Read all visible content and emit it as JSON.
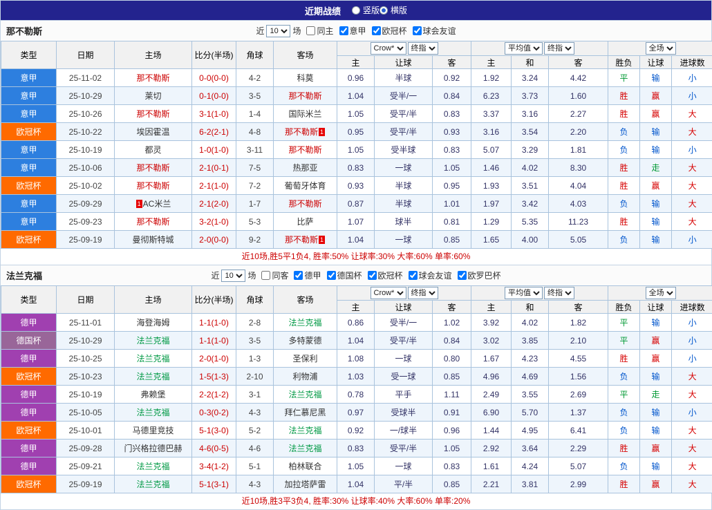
{
  "topbar": {
    "title": "近期战绩",
    "radios": [
      {
        "label": "竖版",
        "selected": false
      },
      {
        "label": "横版",
        "selected": true
      }
    ]
  },
  "columns": {
    "left": [
      "类型",
      "日期",
      "主场",
      "比分(半场)",
      "角球",
      "客场"
    ],
    "asia": [
      "主",
      "让球",
      "客"
    ],
    "euro": [
      "主",
      "和",
      "客"
    ],
    "result": [
      "胜负",
      "让球",
      "进球数"
    ]
  },
  "colors": {
    "topbar_bg": "#23238e",
    "league": {
      "意甲": "#2d7fdf",
      "欧冠杯": "#ff6a00",
      "德甲": "#a040b0",
      "德国杯": "#996699"
    },
    "team_highlight": {
      "那不勒斯": "#cc0000",
      "法兰克福": "#009944"
    },
    "result_map": {
      "胜": "#d60000",
      "平": "#009933",
      "负": "#0055cc",
      "赢": "#d60000",
      "走": "#009933",
      "输": "#0055cc",
      "大": "#d60000",
      "小": "#0055cc"
    },
    "score": "#cc0000",
    "badge": "#e60000"
  },
  "sections": [
    {
      "team": "那不勒斯",
      "filters": {
        "prefix": "近",
        "count": "10",
        "suffix": "场",
        "checkboxes": [
          {
            "label": "同主",
            "checked": false
          },
          {
            "label": "意甲",
            "checked": true
          },
          {
            "label": "欧冠杯",
            "checked": true
          },
          {
            "label": "球会友谊",
            "checked": true
          }
        ]
      },
      "selectors": {
        "asia": [
          "Crow*",
          "终指"
        ],
        "euro": [
          "平均值",
          "终指"
        ],
        "scope": [
          "全场"
        ]
      },
      "rows": [
        {
          "league": "意甲",
          "date": "25-11-02",
          "home": "那不勒斯",
          "score": "0-0(0-0)",
          "corner": "4-2",
          "away": "科莫",
          "asia_home": "0.96",
          "handicap": "半球",
          "asia_away": "0.92",
          "euro_home": "1.92",
          "euro_draw": "3.24",
          "euro_away": "4.42",
          "result": "平",
          "handicap_result": "输",
          "goals": "小"
        },
        {
          "league": "意甲",
          "date": "25-10-29",
          "home": "莱切",
          "score": "0-1(0-0)",
          "corner": "3-5",
          "away": "那不勒斯",
          "asia_home": "1.04",
          "handicap": "受半/一",
          "asia_away": "0.84",
          "euro_home": "6.23",
          "euro_draw": "3.73",
          "euro_away": "1.60",
          "result": "胜",
          "handicap_result": "赢",
          "goals": "小"
        },
        {
          "league": "意甲",
          "date": "25-10-26",
          "home": "那不勒斯",
          "score": "3-1(1-0)",
          "corner": "1-4",
          "away": "国际米兰",
          "asia_home": "1.05",
          "handicap": "受平/半",
          "asia_away": "0.83",
          "euro_home": "3.37",
          "euro_draw": "3.16",
          "euro_away": "2.27",
          "result": "胜",
          "handicap_result": "赢",
          "goals": "大"
        },
        {
          "league": "欧冠杯",
          "date": "25-10-22",
          "home": "埃因霍温",
          "score": "6-2(2-1)",
          "corner": "4-8",
          "away": "那不勒斯",
          "away_badge": "1",
          "asia_home": "0.95",
          "handicap": "受平/半",
          "asia_away": "0.93",
          "euro_home": "3.16",
          "euro_draw": "3.54",
          "euro_away": "2.20",
          "result": "负",
          "handicap_result": "输",
          "goals": "大"
        },
        {
          "league": "意甲",
          "date": "25-10-19",
          "home": "都灵",
          "score": "1-0(1-0)",
          "corner": "3-11",
          "away": "那不勒斯",
          "asia_home": "1.05",
          "handicap": "受半球",
          "asia_away": "0.83",
          "euro_home": "5.07",
          "euro_draw": "3.29",
          "euro_away": "1.81",
          "result": "负",
          "handicap_result": "输",
          "goals": "小"
        },
        {
          "league": "意甲",
          "date": "25-10-06",
          "home": "那不勒斯",
          "score": "2-1(0-1)",
          "corner": "7-5",
          "away": "热那亚",
          "asia_home": "0.83",
          "handicap": "一球",
          "asia_away": "1.05",
          "euro_home": "1.46",
          "euro_draw": "4.02",
          "euro_away": "8.30",
          "result": "胜",
          "handicap_result": "走",
          "goals": "大"
        },
        {
          "league": "欧冠杯",
          "date": "25-10-02",
          "home": "那不勒斯",
          "score": "2-1(1-0)",
          "corner": "7-2",
          "away": "葡萄牙体育",
          "asia_home": "0.93",
          "handicap": "半球",
          "asia_away": "0.95",
          "euro_home": "1.93",
          "euro_draw": "3.51",
          "euro_away": "4.04",
          "result": "胜",
          "handicap_result": "赢",
          "goals": "大"
        },
        {
          "league": "意甲",
          "date": "25-09-29",
          "home": "AC米兰",
          "home_badge": "1",
          "score": "2-1(2-0)",
          "corner": "1-7",
          "away": "那不勒斯",
          "asia_home": "0.87",
          "handicap": "半球",
          "asia_away": "1.01",
          "euro_home": "1.97",
          "euro_draw": "3.42",
          "euro_away": "4.03",
          "result": "负",
          "handicap_result": "输",
          "goals": "大"
        },
        {
          "league": "意甲",
          "date": "25-09-23",
          "home": "那不勒斯",
          "score": "3-2(1-0)",
          "corner": "5-3",
          "away": "比萨",
          "asia_home": "1.07",
          "handicap": "球半",
          "asia_away": "0.81",
          "euro_home": "1.29",
          "euro_draw": "5.35",
          "euro_away": "11.23",
          "result": "胜",
          "handicap_result": "输",
          "goals": "大"
        },
        {
          "league": "欧冠杯",
          "date": "25-09-19",
          "home": "曼彻斯特城",
          "score": "2-0(0-0)",
          "corner": "9-2",
          "away": "那不勒斯",
          "away_badge": "1",
          "asia_home": "1.04",
          "handicap": "一球",
          "asia_away": "0.85",
          "euro_home": "1.65",
          "euro_draw": "4.00",
          "euro_away": "5.05",
          "result": "负",
          "handicap_result": "输",
          "goals": "小"
        }
      ],
      "summary": "近10场,胜5平1负4, 胜率:50% 让球率:30% 大率:60% 单率:60%"
    },
    {
      "team": "法兰克福",
      "filters": {
        "prefix": "近",
        "count": "10",
        "suffix": "场",
        "checkboxes": [
          {
            "label": "同客",
            "checked": false
          },
          {
            "label": "德甲",
            "checked": true
          },
          {
            "label": "德国杯",
            "checked": true
          },
          {
            "label": "欧冠杯",
            "checked": true
          },
          {
            "label": "球会友谊",
            "checked": true
          },
          {
            "label": "欧罗巴杯",
            "checked": true
          }
        ]
      },
      "selectors": {
        "asia": [
          "Crow*",
          "终指"
        ],
        "euro": [
          "平均值",
          "终指"
        ],
        "scope": [
          "全场"
        ]
      },
      "rows": [
        {
          "league": "德甲",
          "date": "25-11-01",
          "home": "海登海姆",
          "score": "1-1(1-0)",
          "corner": "2-8",
          "away": "法兰克福",
          "asia_home": "0.86",
          "handicap": "受半/一",
          "asia_away": "1.02",
          "euro_home": "3.92",
          "euro_draw": "4.02",
          "euro_away": "1.82",
          "result": "平",
          "handicap_result": "输",
          "goals": "小"
        },
        {
          "league": "德国杯",
          "date": "25-10-29",
          "home": "法兰克福",
          "score": "1-1(1-0)",
          "corner": "3-5",
          "away": "多特蒙德",
          "asia_home": "1.04",
          "handicap": "受平/半",
          "asia_away": "0.84",
          "euro_home": "3.02",
          "euro_draw": "3.85",
          "euro_away": "2.10",
          "result": "平",
          "handicap_result": "赢",
          "goals": "小"
        },
        {
          "league": "德甲",
          "date": "25-10-25",
          "home": "法兰克福",
          "score": "2-0(1-0)",
          "corner": "1-3",
          "away": "圣保利",
          "asia_home": "1.08",
          "handicap": "一球",
          "asia_away": "0.80",
          "euro_home": "1.67",
          "euro_draw": "4.23",
          "euro_away": "4.55",
          "result": "胜",
          "handicap_result": "赢",
          "goals": "小"
        },
        {
          "league": "欧冠杯",
          "date": "25-10-23",
          "home": "法兰克福",
          "score": "1-5(1-3)",
          "corner": "2-10",
          "away": "利物浦",
          "asia_home": "1.03",
          "handicap": "受一球",
          "asia_away": "0.85",
          "euro_home": "4.96",
          "euro_draw": "4.69",
          "euro_away": "1.56",
          "result": "负",
          "handicap_result": "输",
          "goals": "大"
        },
        {
          "league": "德甲",
          "date": "25-10-19",
          "home": "弗赖堡",
          "score": "2-2(1-2)",
          "corner": "3-1",
          "away": "法兰克福",
          "asia_home": "0.78",
          "handicap": "平手",
          "asia_away": "1.11",
          "euro_home": "2.49",
          "euro_draw": "3.55",
          "euro_away": "2.69",
          "result": "平",
          "handicap_result": "走",
          "goals": "大"
        },
        {
          "league": "德甲",
          "date": "25-10-05",
          "home": "法兰克福",
          "score": "0-3(0-2)",
          "corner": "4-3",
          "away": "拜仁慕尼黑",
          "asia_home": "0.97",
          "handicap": "受球半",
          "asia_away": "0.91",
          "euro_home": "6.90",
          "euro_draw": "5.70",
          "euro_away": "1.37",
          "result": "负",
          "handicap_result": "输",
          "goals": "小"
        },
        {
          "league": "欧冠杯",
          "date": "25-10-01",
          "home": "马德里竞技",
          "score": "5-1(3-0)",
          "corner": "5-2",
          "away": "法兰克福",
          "asia_home": "0.92",
          "handicap": "一/球半",
          "asia_away": "0.96",
          "euro_home": "1.44",
          "euro_draw": "4.95",
          "euro_away": "6.41",
          "result": "负",
          "handicap_result": "输",
          "goals": "大"
        },
        {
          "league": "德甲",
          "date": "25-09-28",
          "home": "门兴格拉德巴赫",
          "score": "4-6(0-5)",
          "corner": "4-6",
          "away": "法兰克福",
          "asia_home": "0.83",
          "handicap": "受平/半",
          "asia_away": "1.05",
          "euro_home": "2.92",
          "euro_draw": "3.64",
          "euro_away": "2.29",
          "result": "胜",
          "handicap_result": "赢",
          "goals": "大"
        },
        {
          "league": "德甲",
          "date": "25-09-21",
          "home": "法兰克福",
          "score": "3-4(1-2)",
          "corner": "5-1",
          "away": "柏林联合",
          "asia_home": "1.05",
          "handicap": "一球",
          "asia_away": "0.83",
          "euro_home": "1.61",
          "euro_draw": "4.24",
          "euro_away": "5.07",
          "result": "负",
          "handicap_result": "输",
          "goals": "大"
        },
        {
          "league": "欧冠杯",
          "date": "25-09-19",
          "home": "法兰克福",
          "score": "5-1(3-1)",
          "corner": "4-3",
          "away": "加拉塔萨雷",
          "asia_home": "1.04",
          "handicap": "平/半",
          "asia_away": "0.85",
          "euro_home": "2.21",
          "euro_draw": "3.81",
          "euro_away": "2.99",
          "result": "胜",
          "handicap_result": "赢",
          "goals": "大"
        }
      ],
      "summary": "近10场,胜3平3负4, 胜率:30% 让球率:40% 大率:60% 单率:20%"
    }
  ]
}
